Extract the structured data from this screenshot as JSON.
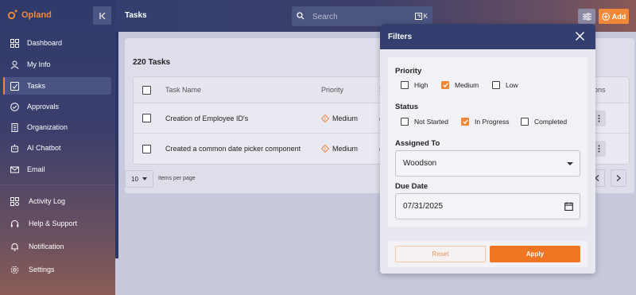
{
  "app": {
    "name": "Opland"
  },
  "colors": {
    "accent": "#f0883a",
    "sidebar": "#2f3a6b",
    "apply": "#f07522"
  },
  "sidebar": {
    "items": [
      {
        "label": "Dashboard",
        "icon": "dashboard-icon"
      },
      {
        "label": "My Info",
        "icon": "user-icon"
      },
      {
        "label": "Tasks",
        "icon": "tasks-icon",
        "active": true
      },
      {
        "label": "Approvals",
        "icon": "check-circle-icon"
      },
      {
        "label": "Organization",
        "icon": "building-icon"
      },
      {
        "label": "AI Chatbot",
        "icon": "robot-icon"
      },
      {
        "label": "Email",
        "icon": "mail-icon"
      }
    ],
    "lower_items": [
      {
        "label": "Activity Log",
        "icon": "activity-log-icon"
      },
      {
        "label": "Help & Support",
        "icon": "help-icon"
      },
      {
        "label": "Notification",
        "icon": "bell-icon"
      },
      {
        "label": "Settings",
        "icon": "gear-icon"
      }
    ]
  },
  "header": {
    "title": "Tasks",
    "search_placeholder": "Search",
    "search_shortcut": "K",
    "add_label": "Add"
  },
  "main": {
    "count_title": "220 Tasks",
    "columns": {
      "select": "",
      "name": "Task Name",
      "priority": "Priority",
      "status": "S",
      "actions": "ions"
    },
    "rows": [
      {
        "name": "Creation of Employee ID's",
        "priority": "Medium",
        "status": "("
      },
      {
        "name": "Created a common date picker component",
        "priority": "Medium",
        "status": "("
      }
    ],
    "per_page_value": "10",
    "per_page_label": "Items per page"
  },
  "filters": {
    "title": "Filters",
    "priority_label": "Priority",
    "priority_options": [
      {
        "label": "High",
        "checked": false
      },
      {
        "label": "Medium",
        "checked": true
      },
      {
        "label": "Low",
        "checked": false
      }
    ],
    "status_label": "Status",
    "status_options": [
      {
        "label": "Not Started",
        "checked": false
      },
      {
        "label": "In Progress",
        "checked": true
      },
      {
        "label": "Completed",
        "checked": false
      }
    ],
    "assigned_label": "Assigned To",
    "assigned_value": "Woodson",
    "due_label": "Due Date",
    "due_value": "07/31/2025",
    "reset_label": "Reset",
    "apply_label": "Apply"
  }
}
